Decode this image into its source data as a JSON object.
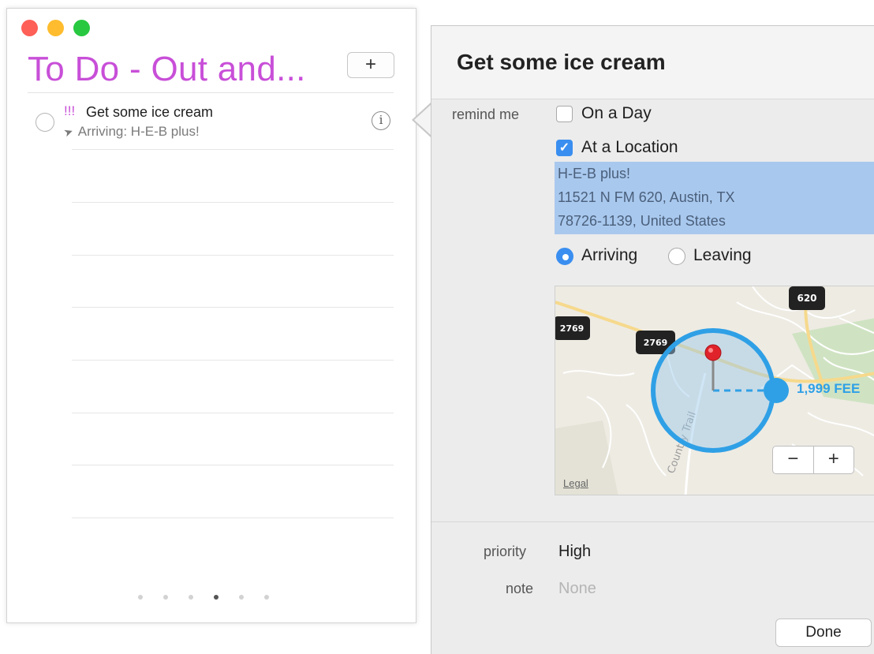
{
  "list": {
    "title": "To Do - Out and...",
    "add_label": "+",
    "task": {
      "priority_marks": "!!!",
      "title": "Get some ice cream",
      "subtitle": "Arriving: H-E-B plus!",
      "location_icon": "location-arrow-icon",
      "info_icon": "info-icon"
    },
    "pager": {
      "pages": 6,
      "active_index": 3
    }
  },
  "detail": {
    "title": "Get some ice cream",
    "remind_me_label": "remind me",
    "on_a_day": {
      "label": "On a Day",
      "checked": false
    },
    "at_a_location": {
      "label": "At a Location",
      "checked": true
    },
    "address": {
      "line1": "H-E-B plus!",
      "line2": "11521 N FM 620, Austin, TX",
      "line3": "78726-1139, United States"
    },
    "arriving": {
      "label": "Arriving",
      "selected": true
    },
    "leaving": {
      "label": "Leaving",
      "selected": false
    },
    "map": {
      "shields": [
        "620",
        "2769",
        "2769"
      ],
      "street_label": "Country Trail",
      "radius_label": "1,999 FEE",
      "legal_label": "Legal",
      "zoom_out": "−",
      "zoom_in": "+"
    },
    "priority_label": "priority",
    "priority_value": "High",
    "note_label": "note",
    "note_value": "None",
    "done_label": "Done"
  },
  "colors": {
    "list_accent": "#c84fd8",
    "checkbox_blue": "#3a8ef0",
    "selection": "#a9c8ee",
    "geofence": "#2fa0e6",
    "pin": "#e0232a"
  }
}
